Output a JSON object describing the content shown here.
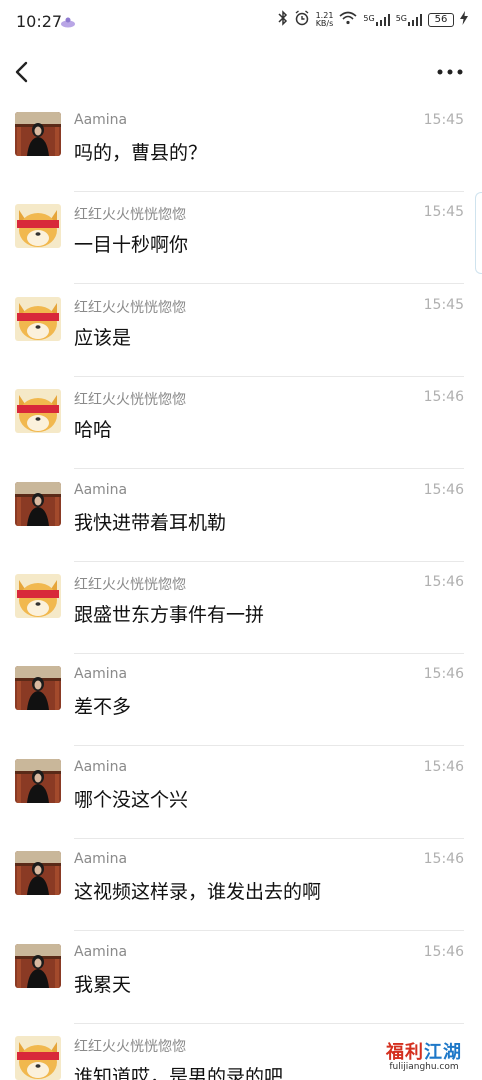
{
  "status_bar": {
    "time": "10:27",
    "net_speed_value": "1.21",
    "net_speed_unit": "KB/s",
    "signal_1": "5G",
    "signal_2": "5G",
    "battery": "56"
  },
  "icons": {
    "back": "chevron-left-icon",
    "more": "more-horizontal-icon",
    "bluetooth": "bluetooth-icon",
    "alarm": "alarm-clock-icon",
    "wifi": "wifi-icon",
    "charging": "charging-bolt-icon"
  },
  "messages": [
    {
      "sender": "Aamina",
      "time": "15:45",
      "text": "吗的，曹县的？",
      "avatar": "woman"
    },
    {
      "sender": "红红火火恍恍惚惚",
      "time": "15:45",
      "text": "一目十秒啊你",
      "avatar": "dog"
    },
    {
      "sender": "红红火火恍恍惚惚",
      "time": "15:45",
      "text": "应该是",
      "avatar": "dog"
    },
    {
      "sender": "红红火火恍恍惚惚",
      "time": "15:46",
      "text": "哈哈",
      "avatar": "dog"
    },
    {
      "sender": "Aamina",
      "time": "15:46",
      "text": "我快进带着耳机勒",
      "avatar": "woman"
    },
    {
      "sender": "红红火火恍恍惚惚",
      "time": "15:46",
      "text": "跟盛世东方事件有一拼",
      "avatar": "dog"
    },
    {
      "sender": "Aamina",
      "time": "15:46",
      "text": "差不多",
      "avatar": "woman"
    },
    {
      "sender": "Aamina",
      "time": "15:46",
      "text": "哪个没这个兴",
      "avatar": "woman"
    },
    {
      "sender": "Aamina",
      "time": "15:46",
      "text": "这视频这样录，谁发出去的啊",
      "avatar": "woman"
    },
    {
      "sender": "Aamina",
      "time": "15:46",
      "text": "我累天",
      "avatar": "woman"
    },
    {
      "sender": "红红火火恍恍惚惚",
      "time": "",
      "text": "谁知道哎，是男的录的吧",
      "avatar": "dog"
    }
  ],
  "watermark": {
    "title_a": "福利",
    "title_b": "江湖",
    "url": "fulijianghu.com"
  },
  "colors": {
    "sender": "#8a8a8a",
    "time": "#b0b0b0",
    "text": "#111111",
    "divider": "#e8e8e8",
    "watermark_red": "#d4301f",
    "watermark_blue": "#1e78c8"
  }
}
